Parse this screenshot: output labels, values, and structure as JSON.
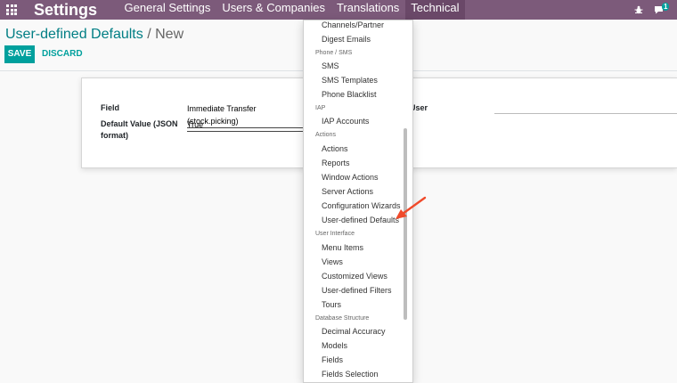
{
  "navbar": {
    "brand": "Settings",
    "menu": [
      "General Settings",
      "Users & Companies",
      "Translations",
      "Technical"
    ],
    "active_menu": "Technical",
    "chat_count": "1",
    "accent": "#7c5a7a"
  },
  "breadcrumb": {
    "parent": "User-defined Defaults",
    "separator": "/",
    "current": "New"
  },
  "buttons": {
    "save": "SAVE",
    "discard": "DISCARD"
  },
  "form": {
    "field_label": "Field",
    "field_value": "Immediate Transfer (stock.picking)",
    "default_value_label_line1": "Default Value (JSON",
    "default_value_label_line2": "format)",
    "default_value": "True",
    "user_label": "User",
    "user_value": ""
  },
  "technical_menu": {
    "sections": [
      {
        "header": "",
        "items": [
          "Channels/Partner",
          "Digest Emails"
        ]
      },
      {
        "header": "Phone / SMS",
        "items": [
          "SMS",
          "SMS Templates",
          "Phone Blacklist"
        ]
      },
      {
        "header": "IAP",
        "items": [
          "IAP Accounts"
        ]
      },
      {
        "header": "Actions",
        "items": [
          "Actions",
          "Reports",
          "Window Actions",
          "Server Actions",
          "Configuration Wizards",
          "User-defined Defaults"
        ]
      },
      {
        "header": "User Interface",
        "items": [
          "Menu Items",
          "Views",
          "Customized Views",
          "User-defined Filters",
          "Tours"
        ]
      },
      {
        "header": "Database Structure",
        "items": [
          "Decimal Accuracy",
          "Models",
          "Fields",
          "Fields Selection"
        ]
      }
    ],
    "highlighted_item": "User-defined Defaults"
  },
  "colors": {
    "primary": "#00a09d",
    "link": "#017e84",
    "annotation_arrow": "#f04a2b"
  }
}
